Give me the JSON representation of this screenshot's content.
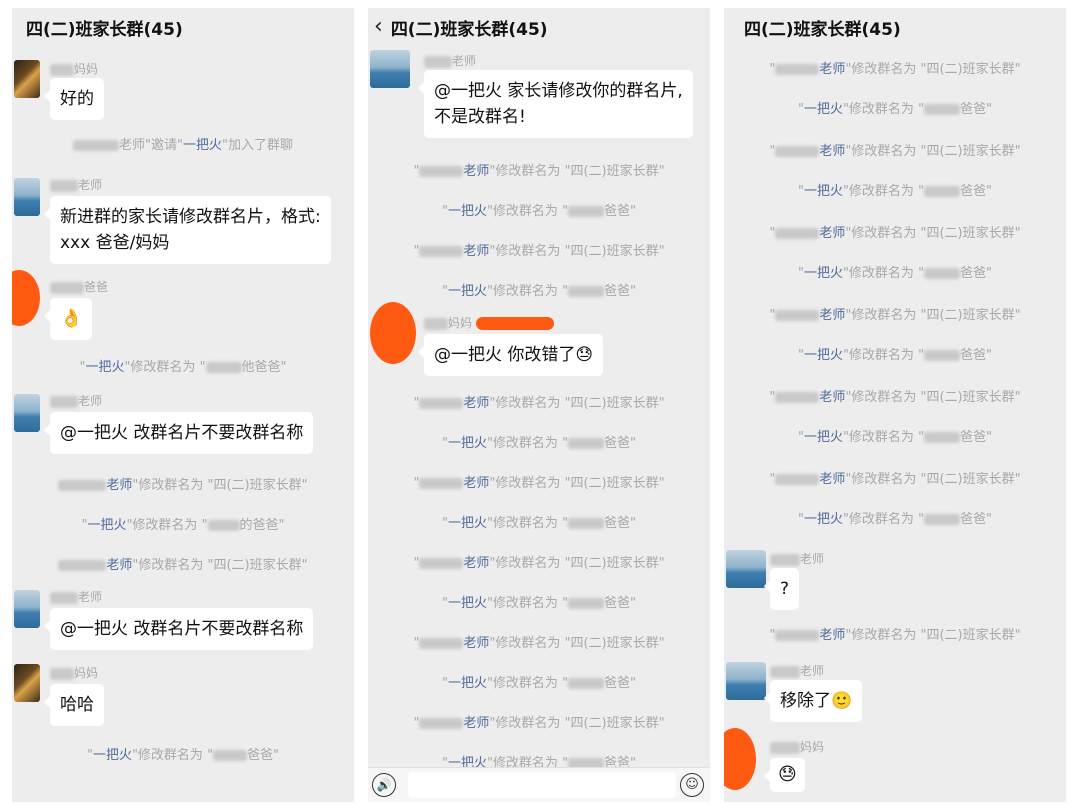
{
  "panels": [
    {
      "title": "四(二)班家长群(45)",
      "items": [
        {
          "kind": "msg",
          "avatar": "night",
          "name_suffix": "妈妈",
          "text": "好的"
        },
        {
          "kind": "sys",
          "parts": [
            {
              "t": "",
              "blur": true
            },
            {
              "t": "老师\"邀请\""
            },
            {
              "t": "一把火",
              "hl": true
            },
            {
              "t": "\"加入了群聊"
            }
          ]
        },
        {
          "kind": "msg",
          "avatar": "sea",
          "name_suffix": "老师",
          "lines": [
            "新进群的家长请修改群名片，格式:",
            "xxx 爸爸/妈妈"
          ]
        },
        {
          "kind": "msg",
          "avatar": "orange",
          "name_suffix": "爸爸",
          "text": "👌"
        },
        {
          "kind": "sys",
          "parts": [
            {
              "t": "\""
            },
            {
              "t": "一把火",
              "hl": true
            },
            {
              "t": "\"修改群名为 \""
            },
            {
              "t": "",
              "blur": true
            },
            {
              "t": "他爸爸\""
            }
          ]
        },
        {
          "kind": "msg",
          "avatar": "sea",
          "name_suffix": "老师",
          "text": "@一把火  改群名片不要改群名称"
        },
        {
          "kind": "sys",
          "parts": [
            {
              "t": "",
              "blur": true
            },
            {
              "t": "老师",
              "hl": true
            },
            {
              "t": "\"修改群名为 \"四(二)班家长群\""
            }
          ]
        },
        {
          "kind": "sys",
          "parts": [
            {
              "t": "\""
            },
            {
              "t": "一把火",
              "hl": true
            },
            {
              "t": "\"修改群名为 \""
            },
            {
              "t": "",
              "blur": true
            },
            {
              "t": "的爸爸\""
            }
          ]
        },
        {
          "kind": "sys",
          "parts": [
            {
              "t": "",
              "blur": true
            },
            {
              "t": "老师",
              "hl": true
            },
            {
              "t": "\"修改群名为 \"四(二)班家长群\""
            }
          ]
        },
        {
          "kind": "msg",
          "avatar": "sea",
          "name_suffix": "老师",
          "text": "@一把火  改群名片不要改群名称"
        },
        {
          "kind": "msg",
          "avatar": "night",
          "name_suffix": "妈妈",
          "text": "哈哈"
        },
        {
          "kind": "sys",
          "parts": [
            {
              "t": "\""
            },
            {
              "t": "一把火",
              "hl": true
            },
            {
              "t": "\"修改群名为 \""
            },
            {
              "t": "",
              "blur": true
            },
            {
              "t": "爸爸\""
            }
          ]
        }
      ]
    },
    {
      "title": "四(二)班家长群(45)",
      "back_icon": "‹",
      "items": [
        {
          "kind": "msg",
          "avatar": "sea",
          "name_suffix": "老师",
          "lines": [
            "@一把火  家长请修改你的群名片,",
            "不是改群名!"
          ]
        },
        {
          "kind": "sys",
          "parts": [
            {
              "t": "\""
            },
            {
              "t": "",
              "blur": true
            },
            {
              "t": "老师",
              "hl": true
            },
            {
              "t": "\"修改群名为 \"四(二)班家长群\""
            }
          ]
        },
        {
          "kind": "sys",
          "parts": [
            {
              "t": "\""
            },
            {
              "t": "一把火",
              "hl": true
            },
            {
              "t": "\"修改群名为 \""
            },
            {
              "t": "",
              "blur": true
            },
            {
              "t": "爸爸\""
            }
          ]
        },
        {
          "kind": "sys",
          "parts": [
            {
              "t": "\""
            },
            {
              "t": "",
              "blur": true
            },
            {
              "t": "老师",
              "hl": true
            },
            {
              "t": "\"修改群名为 \"四(二)班家长群\""
            }
          ]
        },
        {
          "kind": "sys",
          "parts": [
            {
              "t": "\""
            },
            {
              "t": "一把火",
              "hl": true
            },
            {
              "t": "\"修改群名为 \""
            },
            {
              "t": "",
              "blur": true
            },
            {
              "t": "爸爸\""
            }
          ]
        },
        {
          "kind": "msg",
          "avatar": "orange",
          "name_suffix": "妈妈",
          "redact": true,
          "text": "@一把火  你改错了😓"
        },
        {
          "kind": "sys",
          "parts": [
            {
              "t": "\""
            },
            {
              "t": "",
              "blur": true
            },
            {
              "t": "老师",
              "hl": true
            },
            {
              "t": "\"修改群名为 \"四(二)班家长群\""
            }
          ]
        },
        {
          "kind": "sys",
          "parts": [
            {
              "t": "\""
            },
            {
              "t": "一把火",
              "hl": true
            },
            {
              "t": "\"修改群名为 \""
            },
            {
              "t": "",
              "blur": true
            },
            {
              "t": "爸爸\""
            }
          ]
        },
        {
          "kind": "sys",
          "parts": [
            {
              "t": "\""
            },
            {
              "t": "",
              "blur": true
            },
            {
              "t": "老师",
              "hl": true
            },
            {
              "t": "\"修改群名为 \"四(二)班家长群\""
            }
          ]
        },
        {
          "kind": "sys",
          "parts": [
            {
              "t": "\""
            },
            {
              "t": "一把火",
              "hl": true
            },
            {
              "t": "\"修改群名为 \""
            },
            {
              "t": "",
              "blur": true
            },
            {
              "t": "爸爸\""
            }
          ]
        },
        {
          "kind": "sys",
          "parts": [
            {
              "t": "\""
            },
            {
              "t": "",
              "blur": true
            },
            {
              "t": "老师",
              "hl": true
            },
            {
              "t": "\"修改群名为 \"四(二)班家长群\""
            }
          ]
        },
        {
          "kind": "sys",
          "parts": [
            {
              "t": "\""
            },
            {
              "t": "一把火",
              "hl": true
            },
            {
              "t": "\"修改群名为 \""
            },
            {
              "t": "",
              "blur": true
            },
            {
              "t": "爸爸\""
            }
          ]
        },
        {
          "kind": "sys",
          "parts": [
            {
              "t": "\""
            },
            {
              "t": "",
              "blur": true
            },
            {
              "t": "老师",
              "hl": true
            },
            {
              "t": "\"修改群名为 \"四(二)班家长群\""
            }
          ]
        },
        {
          "kind": "sys",
          "parts": [
            {
              "t": "\""
            },
            {
              "t": "一把火",
              "hl": true
            },
            {
              "t": "\"修改群名为 \""
            },
            {
              "t": "",
              "blur": true
            },
            {
              "t": "爸爸\""
            }
          ]
        },
        {
          "kind": "sys",
          "parts": [
            {
              "t": "\""
            },
            {
              "t": "",
              "blur": true
            },
            {
              "t": "老师",
              "hl": true
            },
            {
              "t": "\"修改群名为 \"四(二)班家长群\""
            }
          ]
        },
        {
          "kind": "sys",
          "parts": [
            {
              "t": "\""
            },
            {
              "t": "一把火",
              "hl": true
            },
            {
              "t": "\"修改群名为 \""
            },
            {
              "t": "",
              "blur": true
            },
            {
              "t": "爸爸\""
            }
          ]
        }
      ],
      "input_bar": {
        "voice_icon": "🔊",
        "emoji_icon": "☺"
      }
    },
    {
      "title": "四(二)班家长群(45)",
      "items": [
        {
          "kind": "sys",
          "parts": [
            {
              "t": "\""
            },
            {
              "t": "",
              "blur": true
            },
            {
              "t": "老师",
              "hl": true
            },
            {
              "t": "\"修改群名为 \"四(二)班家长群\""
            }
          ]
        },
        {
          "kind": "sys",
          "parts": [
            {
              "t": "\""
            },
            {
              "t": "一把火",
              "hl": true
            },
            {
              "t": "\"修改群名为 \""
            },
            {
              "t": "",
              "blur": true
            },
            {
              "t": "爸爸\""
            }
          ]
        },
        {
          "kind": "sys",
          "parts": [
            {
              "t": "\""
            },
            {
              "t": "",
              "blur": true
            },
            {
              "t": "老师",
              "hl": true
            },
            {
              "t": "\"修改群名为 \"四(二)班家长群\""
            }
          ]
        },
        {
          "kind": "sys",
          "parts": [
            {
              "t": "\""
            },
            {
              "t": "一把火",
              "hl": true
            },
            {
              "t": "\"修改群名为 \""
            },
            {
              "t": "",
              "blur": true
            },
            {
              "t": "爸爸\""
            }
          ]
        },
        {
          "kind": "sys",
          "parts": [
            {
              "t": "\""
            },
            {
              "t": "",
              "blur": true
            },
            {
              "t": "老师",
              "hl": true
            },
            {
              "t": "\"修改群名为 \"四(二)班家长群\""
            }
          ]
        },
        {
          "kind": "sys",
          "parts": [
            {
              "t": "\""
            },
            {
              "t": "一把火",
              "hl": true
            },
            {
              "t": "\"修改群名为 \""
            },
            {
              "t": "",
              "blur": true
            },
            {
              "t": "爸爸\""
            }
          ]
        },
        {
          "kind": "sys",
          "parts": [
            {
              "t": "\""
            },
            {
              "t": "",
              "blur": true
            },
            {
              "t": "老师",
              "hl": true
            },
            {
              "t": "\"修改群名为 \"四(二)班家长群\""
            }
          ]
        },
        {
          "kind": "sys",
          "parts": [
            {
              "t": "\""
            },
            {
              "t": "一把火",
              "hl": true
            },
            {
              "t": "\"修改群名为 \""
            },
            {
              "t": "",
              "blur": true
            },
            {
              "t": "爸爸\""
            }
          ]
        },
        {
          "kind": "sys",
          "parts": [
            {
              "t": "\""
            },
            {
              "t": "",
              "blur": true
            },
            {
              "t": "老师",
              "hl": true
            },
            {
              "t": "\"修改群名为 \"四(二)班家长群\""
            }
          ]
        },
        {
          "kind": "sys",
          "parts": [
            {
              "t": "\""
            },
            {
              "t": "一把火",
              "hl": true
            },
            {
              "t": "\"修改群名为 \""
            },
            {
              "t": "",
              "blur": true
            },
            {
              "t": "爸爸\""
            }
          ]
        },
        {
          "kind": "sys",
          "parts": [
            {
              "t": "\""
            },
            {
              "t": "",
              "blur": true
            },
            {
              "t": "老师",
              "hl": true
            },
            {
              "t": "\"修改群名为 \"四(二)班家长群\""
            }
          ]
        },
        {
          "kind": "sys",
          "parts": [
            {
              "t": "\""
            },
            {
              "t": "一把火",
              "hl": true
            },
            {
              "t": "\"修改群名为 \""
            },
            {
              "t": "",
              "blur": true
            },
            {
              "t": "爸爸\""
            }
          ]
        },
        {
          "kind": "msg",
          "avatar": "sea",
          "name_suffix": "老师",
          "text": "?"
        },
        {
          "kind": "sys",
          "parts": [
            {
              "t": "\""
            },
            {
              "t": "",
              "blur": true
            },
            {
              "t": "老师",
              "hl": true
            },
            {
              "t": "\"修改群名为 \"四(二)班家长群\""
            }
          ]
        },
        {
          "kind": "msg",
          "avatar": "sea",
          "name_suffix": "老师",
          "text": "移除了🙂"
        },
        {
          "kind": "msg",
          "avatar": "orange",
          "name_suffix": "妈妈",
          "text": "😓"
        }
      ]
    }
  ]
}
